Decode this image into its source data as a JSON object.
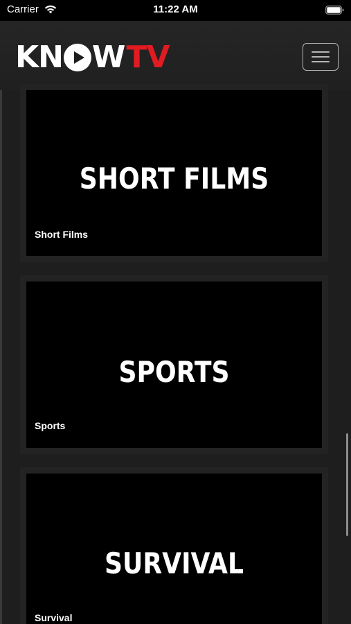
{
  "status_bar": {
    "carrier": "Carrier",
    "time": "11:22 AM",
    "wifi_icon": "wifi-icon",
    "battery_icon": "battery-icon"
  },
  "header": {
    "logo_part1": "KN",
    "logo_part2": "W",
    "logo_part3": "TV",
    "logo_icon": "play-circle-icon",
    "menu_icon": "hamburger-menu-icon"
  },
  "categories": [
    {
      "art_title": "SHORT FILMS",
      "label": "Short Films"
    },
    {
      "art_title": "SPORTS",
      "label": "Sports"
    },
    {
      "art_title": "SURVIVAL",
      "label": "Survival"
    }
  ],
  "colors": {
    "brand_red": "#e01b22",
    "background": "#1e1e1e",
    "card": "#000000"
  }
}
